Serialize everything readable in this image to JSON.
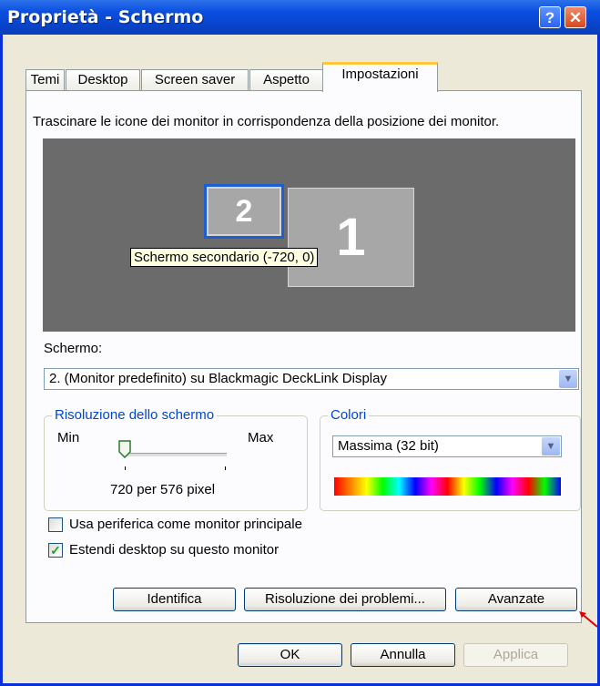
{
  "window": {
    "title": "Proprietà - Schermo",
    "help_glyph": "?",
    "close_glyph": "✕"
  },
  "tabs": [
    {
      "label": "Temi"
    },
    {
      "label": "Desktop"
    },
    {
      "label": "Screen saver"
    },
    {
      "label": "Aspetto"
    },
    {
      "label": "Impostazioni",
      "active": true
    }
  ],
  "instruction": "Trascinare le icone dei monitor in corrispondenza della posizione dei monitor.",
  "monitors": {
    "primary_number": "1",
    "secondary_number": "2",
    "tooltip": "Schermo secondario (-720, 0)"
  },
  "screen": {
    "label": "Schermo:",
    "value": "2. (Monitor predefinito) su Blackmagic DeckLink Display"
  },
  "resolution": {
    "group_title": "Risoluzione dello schermo",
    "min_label": "Min",
    "max_label": "Max",
    "value_text": "720 per 576 pixel",
    "slider_level": 0.0
  },
  "colors": {
    "group_title": "Colori",
    "value": "Massima (32 bit)",
    "palette": [
      "#ff0000",
      "#ff8000",
      "#ffff00",
      "#00ff00",
      "#00ffff",
      "#0000ff",
      "#ff00ff",
      "#ff0000",
      "#ffff00",
      "#00ff00",
      "#0000ff",
      "#ff00ff",
      "#ff0000",
      "#00ff00",
      "#0000ff"
    ]
  },
  "checkboxes": [
    {
      "label": "Usa periferica come monitor principale",
      "checked": false
    },
    {
      "label": "Estendi desktop su questo monitor",
      "checked": true
    }
  ],
  "panel_buttons": {
    "identify": "Identifica",
    "troubleshoot": "Risoluzione dei problemi...",
    "advanced": "Avanzate"
  },
  "dialog_buttons": {
    "ok": "OK",
    "cancel": "Annulla",
    "apply": "Applica"
  },
  "accent_colors": {
    "titlebar": "#0a4ee0",
    "group_title": "#0046d5",
    "arrow": "#e00000"
  }
}
